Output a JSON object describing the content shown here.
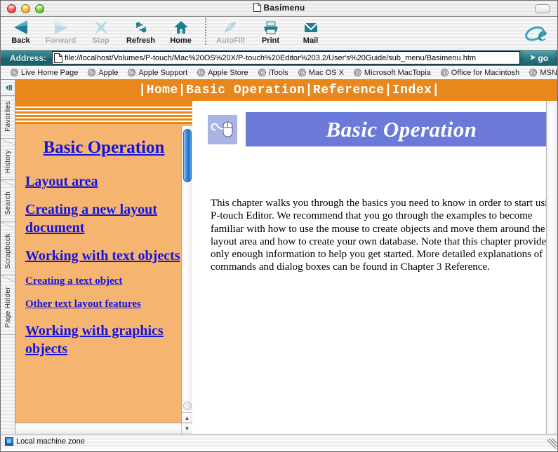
{
  "window": {
    "title": "Basimenu",
    "traffic_lights": [
      "close",
      "minimize",
      "zoom"
    ]
  },
  "toolbar": {
    "items": [
      {
        "label": "Back",
        "icon": "back-triangle-icon",
        "enabled": true
      },
      {
        "label": "Forward",
        "icon": "forward-triangle-icon",
        "enabled": false
      },
      {
        "label": "Stop",
        "icon": "stop-x-icon",
        "enabled": false
      },
      {
        "label": "Refresh",
        "icon": "refresh-arrows-icon",
        "enabled": true
      },
      {
        "label": "Home",
        "icon": "home-house-icon",
        "enabled": true
      },
      {
        "label": "AutoFill",
        "icon": "autofill-pen-icon",
        "enabled": false
      },
      {
        "label": "Print",
        "icon": "printer-icon",
        "enabled": true
      },
      {
        "label": "Mail",
        "icon": "mail-envelope-icon",
        "enabled": true
      }
    ],
    "brand_icon": "internet-explorer-e-icon"
  },
  "address_bar": {
    "label": "Address:",
    "value": "file://localhost/Volumes/P-touch/Mac%20OS%20X/P-touch%20Editor%203.2/User's%20Guide/sub_menu/Basimenu.htm",
    "go_label": "go",
    "page_icon": "page-doc-icon"
  },
  "links_bar": {
    "items": [
      "Live Home Page",
      "Apple",
      "Apple Support",
      "Apple Store",
      "iTools",
      "Mac OS X",
      "Microsoft MacTopia",
      "Office for Macintosh",
      "MSN"
    ]
  },
  "side_tabs": {
    "toggle_icon": "sidebar-toggle-icon",
    "items": [
      "Favorites",
      "History",
      "Search",
      "Scrapbook",
      "Page Holder"
    ]
  },
  "page": {
    "nav": {
      "text": "|Home|Basic Operation|Reference|Index|",
      "background": "#e8871b"
    },
    "left_frame": {
      "background": "#f5b470",
      "link_color": "#1414e0",
      "title": "Basic Operation",
      "links": [
        {
          "label": "Layout area",
          "size": "big"
        },
        {
          "label": "Creating a new layout document",
          "size": "big"
        },
        {
          "label": "Working with text objects",
          "size": "big"
        },
        {
          "label": "Creating a text object",
          "size": "small"
        },
        {
          "label": "Other text layout features",
          "size": "small"
        },
        {
          "label": "Working with graphics objects",
          "size": "big"
        }
      ]
    },
    "right_frame": {
      "banner_icon": "mouse-pointer-icon",
      "banner_title": "Basic Operation",
      "banner_color": "#6b79d8",
      "body": "This chapter walks you through the basics you need to know in order to start using P-touch Editor. We recommend that you go through the examples to become familiar with how to use the mouse to create objects and move them around the layout area and how to create your own database. Note that this chapter provides only enough information to help you get started. More detailed explanations of commands and dialog boxes can be found in Chapter 3 Reference."
    }
  },
  "status_bar": {
    "text": "Local machine zone",
    "icon": "security-zone-icon"
  }
}
